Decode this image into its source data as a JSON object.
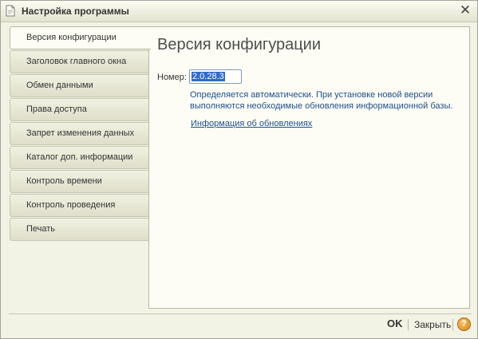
{
  "window": {
    "title": "Настройка программы",
    "close_symbol": "✕",
    "app_icon": "document-icon"
  },
  "tabs": [
    {
      "label": "Версия конфигурации",
      "active": true
    },
    {
      "label": "Заголовок главного окна",
      "active": false
    },
    {
      "label": "Обмен данными",
      "active": false
    },
    {
      "label": "Права доступа",
      "active": false
    },
    {
      "label": "Запрет изменения данных",
      "active": false
    },
    {
      "label": "Каталог доп. информации",
      "active": false
    },
    {
      "label": "Контроль времени",
      "active": false
    },
    {
      "label": "Контроль проведения",
      "active": false
    },
    {
      "label": "Печать",
      "active": false
    }
  ],
  "content": {
    "title": "Версия конфигурации",
    "number_label": "Номер:",
    "number_value": "2.0.28.3",
    "info_text": "Определяется автоматически. При установке новой версии выполняются необходимые обновления информационной базы.",
    "link_text": "Информация об обновлениях"
  },
  "footer": {
    "ok_label": "OK",
    "close_label": "Закрыть",
    "help_symbol": "?"
  },
  "colors": {
    "link": "#1f4e8c",
    "selection": "#316ac5",
    "help_button": "#e29a22"
  }
}
